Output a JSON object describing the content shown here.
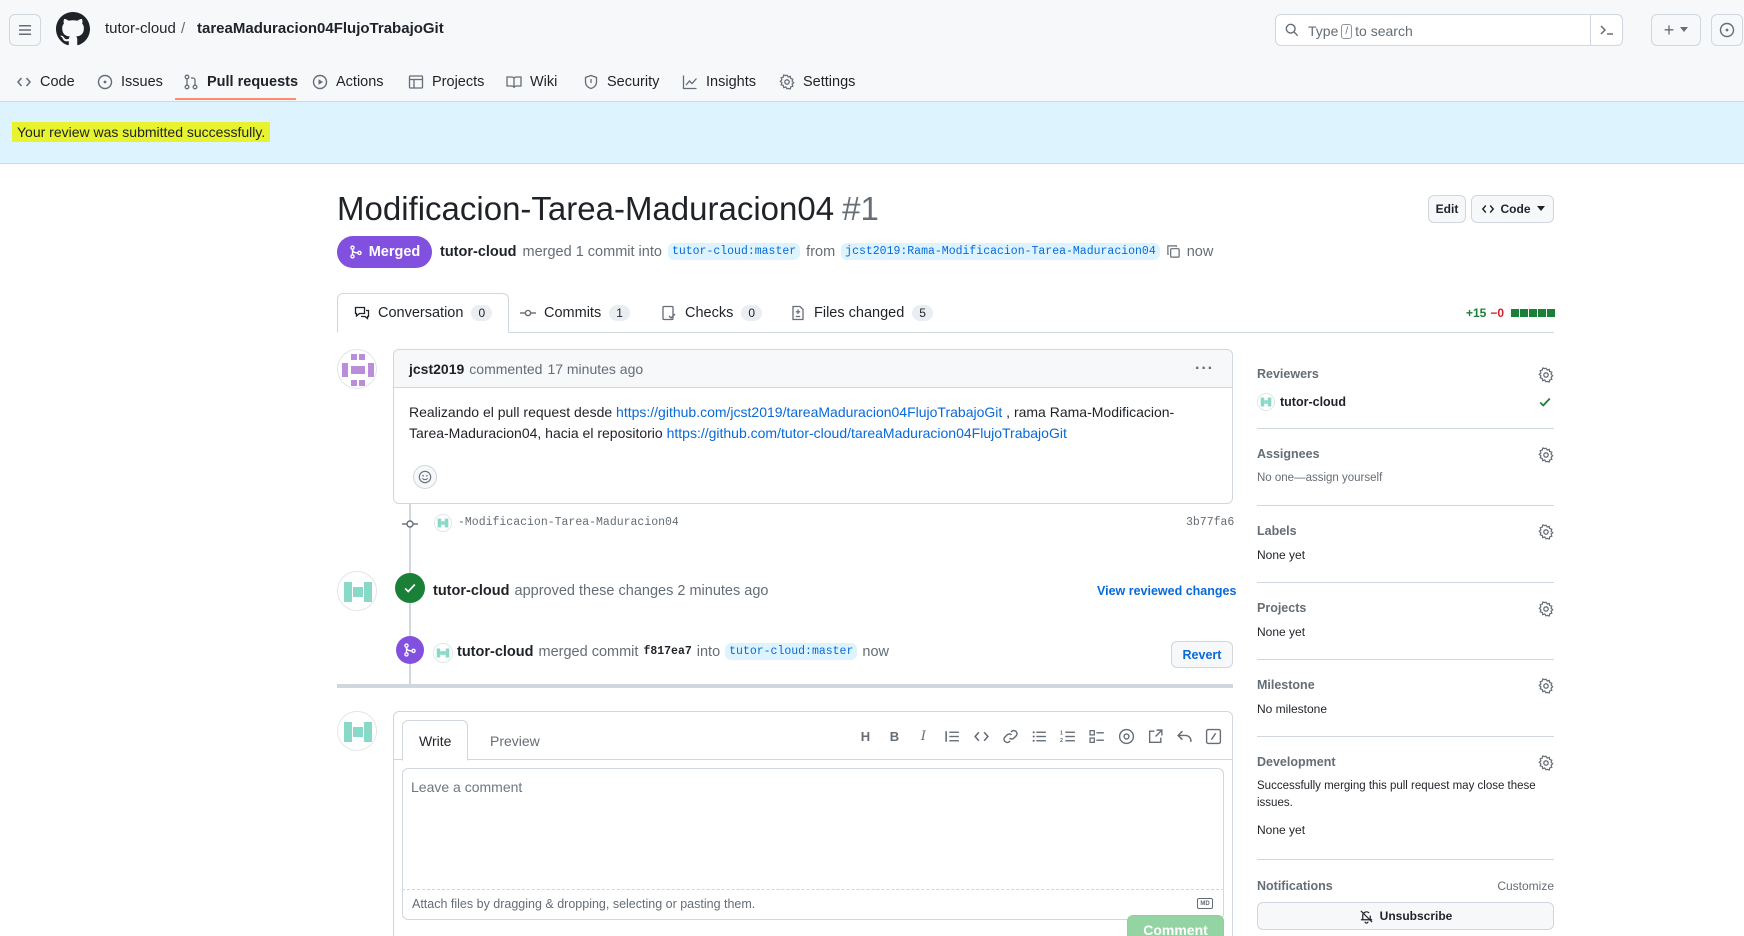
{
  "header": {
    "owner": "tutor-cloud",
    "separator": "/",
    "repo": "tareaMaduracion04FlujoTrabajoGit",
    "search_prefix": "Type",
    "search_key": "/",
    "search_suffix": "to search",
    "new_button_label": "+"
  },
  "nav": [
    {
      "label": "Code",
      "icon": "code-icon"
    },
    {
      "label": "Issues",
      "icon": "issue-icon"
    },
    {
      "label": "Pull requests",
      "icon": "pull-request-icon",
      "active": true
    },
    {
      "label": "Actions",
      "icon": "play-icon"
    },
    {
      "label": "Projects",
      "icon": "table-icon"
    },
    {
      "label": "Wiki",
      "icon": "book-icon"
    },
    {
      "label": "Security",
      "icon": "shield-icon"
    },
    {
      "label": "Insights",
      "icon": "graph-icon"
    },
    {
      "label": "Settings",
      "icon": "gear-icon"
    }
  ],
  "flash": {
    "message": "Your review was submitted successfully."
  },
  "pr": {
    "title": "Modificacion-Tarea-Maduracion04",
    "number": "#1",
    "edit_label": "Edit",
    "code_label": "Code",
    "state": "Merged",
    "author": "tutor-cloud",
    "merged_text": "merged 1 commit into",
    "base_branch": "tutor-cloud:master",
    "from_text": "from",
    "head_branch": "jcst2019:Rama-Modificacion-Tarea-Maduracion04",
    "time": "now"
  },
  "tabs": [
    {
      "label": "Conversation",
      "count": "0",
      "active": true
    },
    {
      "label": "Commits",
      "count": "1"
    },
    {
      "label": "Checks",
      "count": "0"
    },
    {
      "label": "Files changed",
      "count": "5"
    }
  ],
  "diffstat": {
    "additions": "+15",
    "deletions": "−0",
    "blocks": 5
  },
  "comment": {
    "author": "jcst2019",
    "action": "commented",
    "time": "17 minutes ago",
    "text_1": "Realizando el pull request desde",
    "link_1": "https://github.com/jcst2019/tareaMaduracion04FlujoTrabajoGit",
    "text_2": ", rama Rama-Modificacion-",
    "text_3": "Tarea-Maduracion04, hacia el repositorio",
    "link_2": "https://github.com/tutor-cloud/tareaMaduracion04FlujoTrabajoGit"
  },
  "commit": {
    "message": "-Modificacion-Tarea-Maduracion04",
    "sha": "3b77fa6"
  },
  "review_event": {
    "actor": "tutor-cloud",
    "text": "approved these changes 2 minutes ago",
    "link": "View reviewed changes"
  },
  "merge_event": {
    "actor": "tutor-cloud",
    "text_1": "merged commit",
    "sha": "f817ea7",
    "text_2": "into",
    "branch": "tutor-cloud:master",
    "time": "now",
    "revert_label": "Revert"
  },
  "form": {
    "write_tab": "Write",
    "preview_tab": "Preview",
    "placeholder": "Leave a comment",
    "attach_text": "Attach files by dragging & dropping, selecting or pasting them.",
    "markdown_badge": "MD",
    "submit_label": "Comment"
  },
  "sidebar": {
    "reviewers": {
      "title": "Reviewers",
      "name": "tutor-cloud"
    },
    "assignees": {
      "title": "Assignees",
      "value": "No one—assign yourself"
    },
    "labels": {
      "title": "Labels",
      "value": "None yet"
    },
    "projects": {
      "title": "Projects",
      "value": "None yet"
    },
    "milestone": {
      "title": "Milestone",
      "value": "No milestone"
    },
    "development": {
      "title": "Development",
      "description": "Successfully merging this pull request may close these issues.",
      "value": "None yet"
    },
    "notifications": {
      "title": "Notifications",
      "customize": "Customize",
      "unsubscribe": "Unsubscribe"
    }
  },
  "colors": {
    "merged": "#8250df",
    "approved": "#1a7f37",
    "link": "#0969da",
    "flash_bg": "#ddf4ff",
    "highlight": "#e7f32f"
  }
}
